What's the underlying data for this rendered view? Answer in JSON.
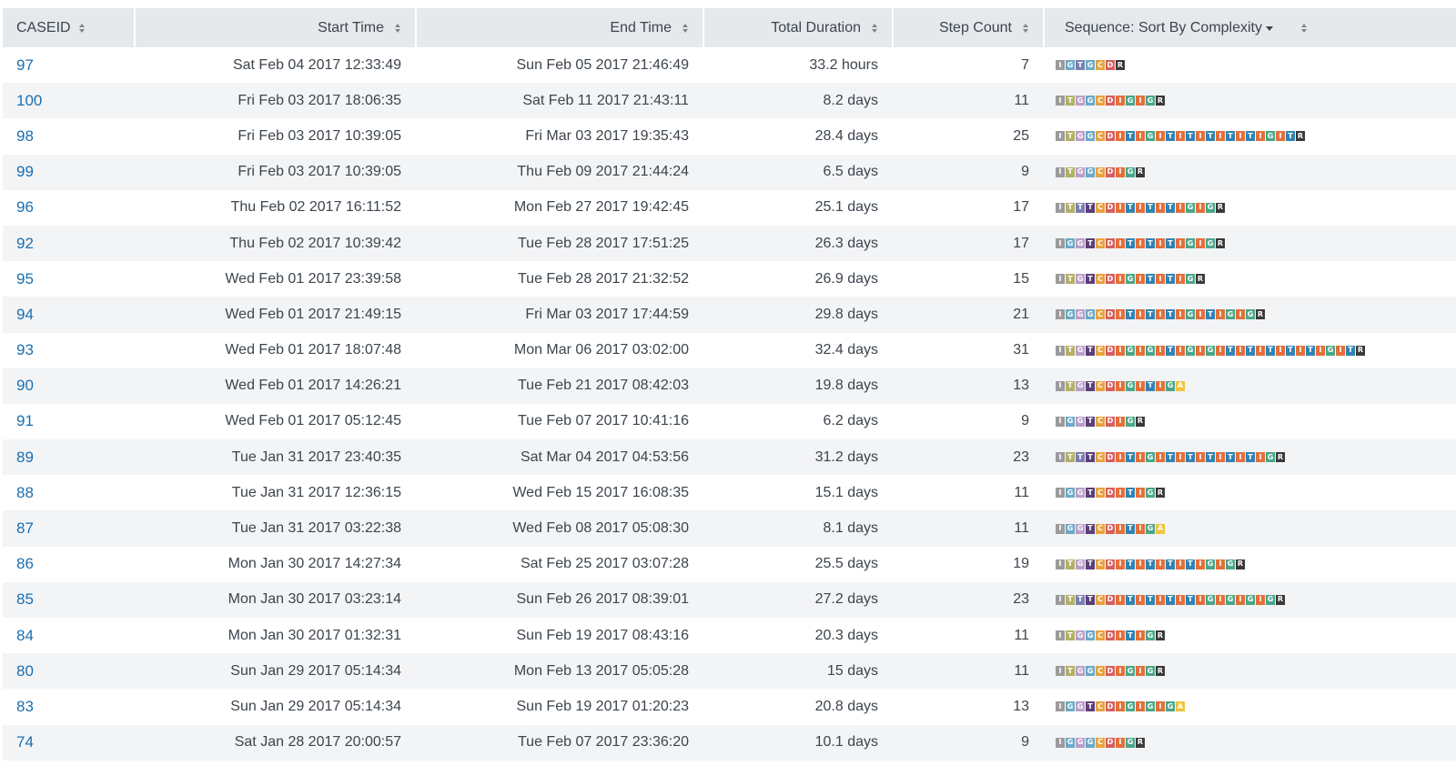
{
  "table": {
    "headers": [
      "CASEID",
      "Start Time",
      "End Time",
      "Total Duration",
      "Step Count",
      "Sequence: Sort By Complexity"
    ],
    "rows": [
      {
        "caseid": "97",
        "start": "Sat Feb 04 2017 12:33:49",
        "end": "Sun Feb 05 2017 21:46:49",
        "duration": "33.2 hours",
        "steps": "7",
        "sequence": "IGTGCDR"
      },
      {
        "caseid": "100",
        "start": "Fri Feb 03 2017 18:06:35",
        "end": "Sat Feb 11 2017 21:43:11",
        "duration": "8.2 days",
        "steps": "11",
        "sequence": "ITGGCDIGIGR"
      },
      {
        "caseid": "98",
        "start": "Fri Feb 03 2017 10:39:05",
        "end": "Fri Mar 03 2017 19:35:43",
        "duration": "28.4 days",
        "steps": "25",
        "sequence": "ITGGCDITIGITITITITITIGITR"
      },
      {
        "caseid": "99",
        "start": "Fri Feb 03 2017 10:39:05",
        "end": "Thu Feb 09 2017 21:44:24",
        "duration": "6.5 days",
        "steps": "9",
        "sequence": "ITGGCDIGR"
      },
      {
        "caseid": "96",
        "start": "Thu Feb 02 2017 16:11:52",
        "end": "Mon Feb 27 2017 19:42:45",
        "duration": "25.1 days",
        "steps": "17",
        "sequence": "ITTTCDITITITIGIGR"
      },
      {
        "caseid": "92",
        "start": "Thu Feb 02 2017 10:39:42",
        "end": "Tue Feb 28 2017 17:51:25",
        "duration": "26.3 days",
        "steps": "17",
        "sequence": "IGGTCDITITITIGIGR"
      },
      {
        "caseid": "95",
        "start": "Wed Feb 01 2017 23:39:58",
        "end": "Tue Feb 28 2017 21:32:52",
        "duration": "26.9 days",
        "steps": "15",
        "sequence": "ITGTCDIGITITIGR"
      },
      {
        "caseid": "94",
        "start": "Wed Feb 01 2017 21:49:15",
        "end": "Fri Mar 03 2017 17:44:59",
        "duration": "29.8 days",
        "steps": "21",
        "sequence": "IGGGCDITITITIGITIGIGR"
      },
      {
        "caseid": "93",
        "start": "Wed Feb 01 2017 18:07:48",
        "end": "Mon Mar 06 2017 03:02:00",
        "duration": "32.4 days",
        "steps": "31",
        "sequence": "ITGTCDIGIGITIGIGITITITITITIGITR"
      },
      {
        "caseid": "90",
        "start": "Wed Feb 01 2017 14:26:21",
        "end": "Tue Feb 21 2017 08:42:03",
        "duration": "19.8 days",
        "steps": "13",
        "sequence": "ITGTCDIGITIGA"
      },
      {
        "caseid": "91",
        "start": "Wed Feb 01 2017 05:12:45",
        "end": "Tue Feb 07 2017 10:41:16",
        "duration": "6.2 days",
        "steps": "9",
        "sequence": "IGGTCDIGR"
      },
      {
        "caseid": "89",
        "start": "Tue Jan 31 2017 23:40:35",
        "end": "Sat Mar 04 2017 04:53:56",
        "duration": "31.2 days",
        "steps": "23",
        "sequence": "ITTTCDITIGITITITITITIGR"
      },
      {
        "caseid": "88",
        "start": "Tue Jan 31 2017 12:36:15",
        "end": "Wed Feb 15 2017 16:08:35",
        "duration": "15.1 days",
        "steps": "11",
        "sequence": "IGGTCDITIGR"
      },
      {
        "caseid": "87",
        "start": "Tue Jan 31 2017 03:22:38",
        "end": "Wed Feb 08 2017 05:08:30",
        "duration": "8.1 days",
        "steps": "11",
        "sequence": "IGGTCDITIGA"
      },
      {
        "caseid": "86",
        "start": "Mon Jan 30 2017 14:27:34",
        "end": "Sat Feb 25 2017 03:07:28",
        "duration": "25.5 days",
        "steps": "19",
        "sequence": "ITGTCDITITITITIGIGR"
      },
      {
        "caseid": "85",
        "start": "Mon Jan 30 2017 03:23:14",
        "end": "Sun Feb 26 2017 08:39:01",
        "duration": "27.2 days",
        "steps": "23",
        "sequence": "ITTTCDITITITITIGIGIGIGR"
      },
      {
        "caseid": "84",
        "start": "Mon Jan 30 2017 01:32:31",
        "end": "Sun Feb 19 2017 08:43:16",
        "duration": "20.3 days",
        "steps": "11",
        "sequence": "ITGGCDITIGR"
      },
      {
        "caseid": "80",
        "start": "Sun Jan 29 2017 05:14:34",
        "end": "Mon Feb 13 2017 05:05:28",
        "duration": "15 days",
        "steps": "11",
        "sequence": "ITGGCDIGIGR"
      },
      {
        "caseid": "83",
        "start": "Sun Jan 29 2017 05:14:34",
        "end": "Sun Feb 19 2017 01:20:23",
        "duration": "20.8 days",
        "steps": "13",
        "sequence": "IGGTCDIGIGIGA"
      },
      {
        "caseid": "74",
        "start": "Sat Jan 28 2017 20:00:57",
        "end": "Tue Feb 07 2017 23:36:20",
        "duration": "10.1 days",
        "steps": "9",
        "sequence": "IGGGCDIGR"
      }
    ]
  },
  "colors": {
    "header_bg": "#e6e9ec",
    "row_alt_bg": "#f3f4f6",
    "link": "#1a6fb0",
    "I_first": "#9b9b9b",
    "I": "#e3703a",
    "T_pos1": "#b2b066",
    "T_pos2": "#7a7fb2",
    "T_pos3": "#5a3f78",
    "T": "#2f83b3",
    "G_pos1": "#6ba9c7",
    "G_pos2": "#b99fc7",
    "G_pos3": "#6ba9c7",
    "G": "#4aa689",
    "C": "#e8a33f",
    "D": "#d85f5f",
    "R": "#3a3a3a",
    "A": "#f0c43e"
  }
}
